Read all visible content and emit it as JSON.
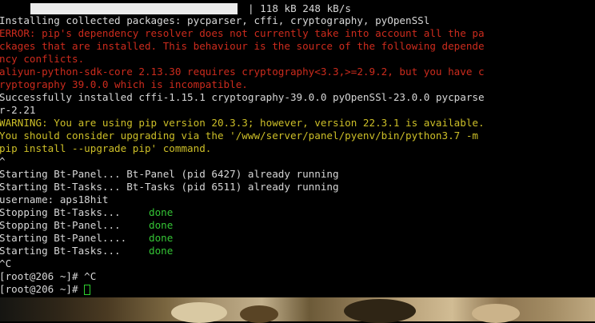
{
  "terminal": {
    "download_progress": 1.0,
    "progress_text": "| 118 kB 248 kB/s",
    "lines": [
      {
        "text": "Installing collected packages: pycparser, cffi, cryptography, pyOpenSSl",
        "style": "default"
      },
      {
        "text": "ERROR: pip's dependency resolver does not currently take into account all the pa",
        "style": "error"
      },
      {
        "text": "ckages that are installed. This behaviour is the source of the following depende",
        "style": "error"
      },
      {
        "text": "ncy conflicts.",
        "style": "error"
      },
      {
        "text": "aliyun-python-sdk-core 2.13.30 requires cryptography<3.3,>=2.9.2, but you have c",
        "style": "error"
      },
      {
        "text": "ryptography 39.0.0 which is incompatible.",
        "style": "error"
      },
      {
        "text": "Successfully installed cffi-1.15.1 cryptography-39.0.0 pyOpenSSl-23.0.0 pycparse",
        "style": "default"
      },
      {
        "text": "r-2.21",
        "style": "default"
      },
      {
        "text": "WARNING: You are using pip version 20.3.3; however, version 22.3.1 is available.",
        "style": "warn"
      },
      {
        "text": "You should consider upgrading via the '/www/server/panel/pyenv/bin/python3.7 -m",
        "style": "warn"
      },
      {
        "text": "pip install --upgrade pip' command.",
        "style": "warn"
      },
      {
        "text": "^",
        "style": "default"
      },
      {
        "text": "Starting Bt-Panel... Bt-Panel (pid 6427) already running",
        "style": "default"
      },
      {
        "text": "Starting Bt-Tasks... Bt-Tasks (pid 6511) already running",
        "style": "default"
      },
      {
        "text": "username: aps18hit",
        "style": "default"
      },
      {
        "text": "Stopping Bt-Tasks...",
        "style": "default",
        "status": "done"
      },
      {
        "text": "Stopping Bt-Panel...",
        "style": "default",
        "status": "done"
      },
      {
        "text": "Starting Bt-Panel....",
        "style": "default",
        "status": "done"
      },
      {
        "text": "Starting Bt-Tasks...",
        "style": "default",
        "status": "done"
      },
      {
        "text": "^C",
        "style": "default"
      },
      {
        "text": "[root@206 ~]# ^C",
        "style": "default"
      },
      {
        "text": "[root@206 ~]# ",
        "style": "default",
        "cursor": true
      }
    ]
  },
  "colors": {
    "background": "#000000",
    "default_text": "#d7d7d7",
    "error_text": "#cc2b1d",
    "warning_text": "#cdbf28",
    "done_text": "#34c435",
    "cursor": "#2ed12e"
  }
}
